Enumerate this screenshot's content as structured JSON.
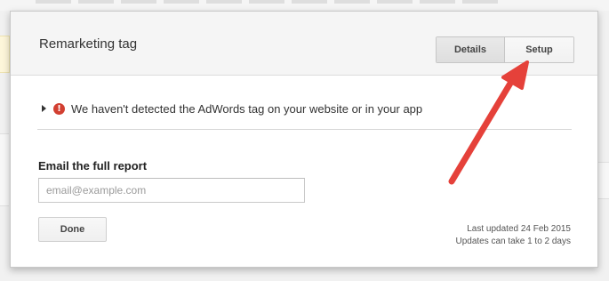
{
  "dialog": {
    "title": "Remarketing tag",
    "tabs": [
      {
        "label": "Details"
      },
      {
        "label": "Setup"
      }
    ],
    "status": {
      "message": "We haven't detected the AdWords tag on your website or in your app",
      "icon": "error-icon",
      "icon_glyph": "!",
      "color": "#d23f31"
    },
    "email": {
      "heading": "Email the full report",
      "placeholder": "email@example.com",
      "value": ""
    },
    "done_label": "Done",
    "last_updated": "Last updated 24 Feb 2015",
    "update_note": "Updates can take 1 to 2 days"
  },
  "annotation": {
    "type": "arrow",
    "color": "#e5413a",
    "points_to": "setup-tab"
  }
}
